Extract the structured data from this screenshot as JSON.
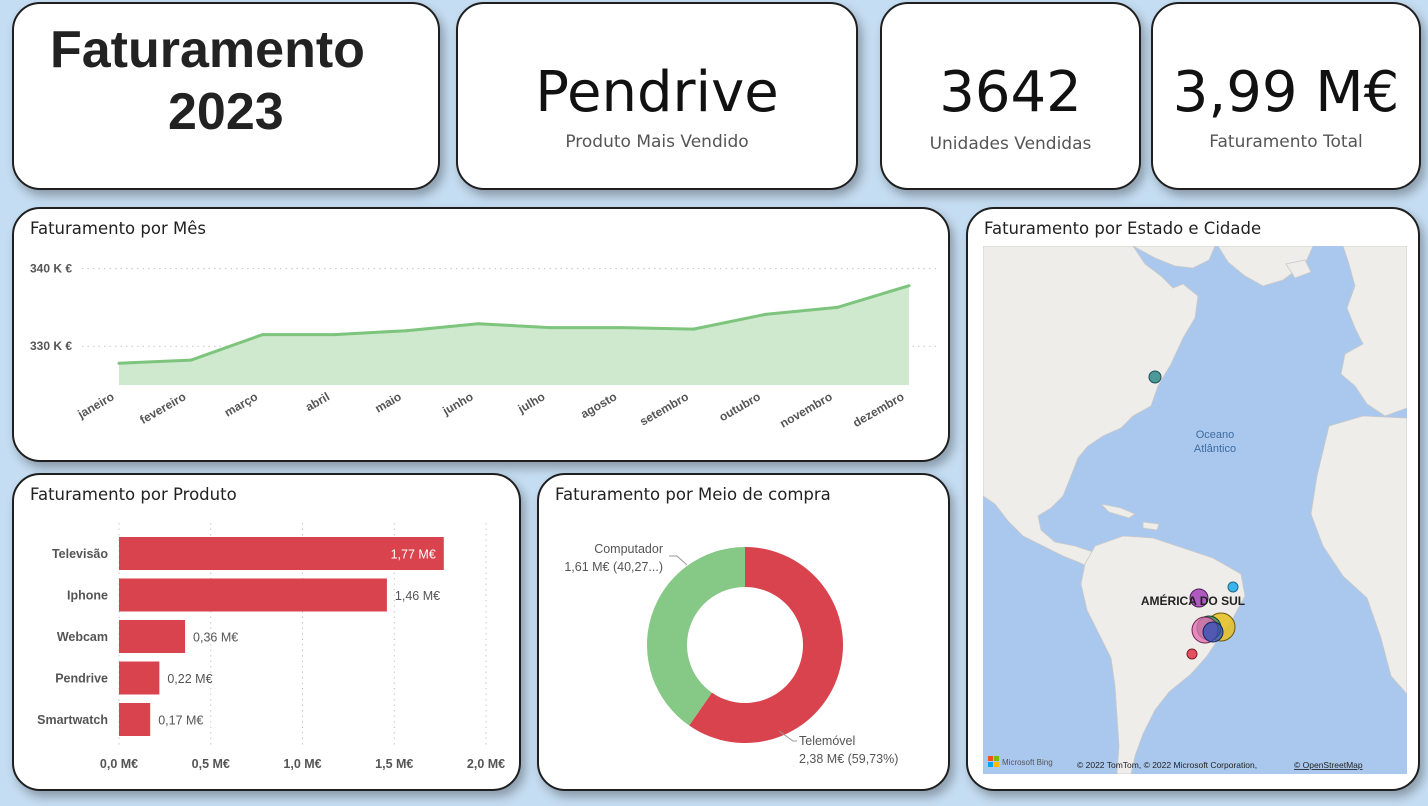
{
  "header": {
    "title_line1": "Faturamento",
    "title_line2": "2023"
  },
  "kpis": {
    "top_product": {
      "value": "Pendrive",
      "label": "Produto Mais Vendido"
    },
    "units_sold": {
      "value": "3642",
      "label": "Unidades Vendidas"
    },
    "total_revenue": {
      "value": "3,99 M€",
      "label": "Faturamento Total"
    }
  },
  "monthly": {
    "title": "Faturamento por Mês",
    "chart_data": {
      "type": "area",
      "x": [
        "janeiro",
        "fevereiro",
        "março",
        "abril",
        "maio",
        "junho",
        "julho",
        "agosto",
        "setembro",
        "outubro",
        "novembro",
        "dezembro"
      ],
      "values": [
        327.8,
        328.2,
        331.5,
        331.5,
        332.0,
        332.9,
        332.4,
        332.4,
        332.2,
        334.1,
        335.0,
        337.8
      ],
      "ytick_labels": [
        "340 K €",
        "330 K €"
      ],
      "yticks": [
        340,
        330
      ],
      "ylim": [
        325.0,
        341.5
      ],
      "color": "#7dc47d",
      "fill_color": "#cfe9cf",
      "grid": true
    }
  },
  "products": {
    "title": "Faturamento por Produto",
    "chart_data": {
      "type": "bar",
      "orientation": "horizontal",
      "categories": [
        "Televisão",
        "Iphone",
        "Webcam",
        "Pendrive",
        "Smartwatch"
      ],
      "values": [
        1.77,
        1.46,
        0.36,
        0.22,
        0.17
      ],
      "value_labels": [
        "1,77 M€",
        "1,46 M€",
        "0,36 M€",
        "0,22 M€",
        "0,17 M€"
      ],
      "xticks": [
        0,
        0.5,
        1.0,
        1.5,
        2.0
      ],
      "xtick_labels": [
        "0,0 M€",
        "0,5 M€",
        "1,0 M€",
        "1,5 M€",
        "2,0 M€"
      ],
      "xlim": [
        0,
        2.0
      ],
      "color": "#d9434e",
      "grid": true
    }
  },
  "purchase": {
    "title": "Faturamento por Meio de compra",
    "chart_data": {
      "type": "pie",
      "donut": true,
      "slices": [
        {
          "name": "Telemóvel",
          "value": 2.38,
          "label_line1": "Telemóvel",
          "label_line2": "2,38 M€ (59,73%)",
          "color": "#d9434e"
        },
        {
          "name": "Computador",
          "value": 1.61,
          "label_line1": "Computador",
          "label_line2": "1,61 M€ (40,27...)",
          "color": "#86c886"
        }
      ]
    }
  },
  "map": {
    "title": "Faturamento por Estado e Cidade",
    "ocean_label_line1": "Oceano",
    "ocean_label_line2": "Atlântico",
    "region_label": "AMÉRICA DO SUL",
    "attribution": "© 2022 TomTom, © 2022 Microsoft Corporation,",
    "attribution_link": "© OpenStreetMap",
    "logo_text": "Microsoft Bing",
    "land_color": "#eeede9",
    "water_color": "#aac8ee"
  }
}
